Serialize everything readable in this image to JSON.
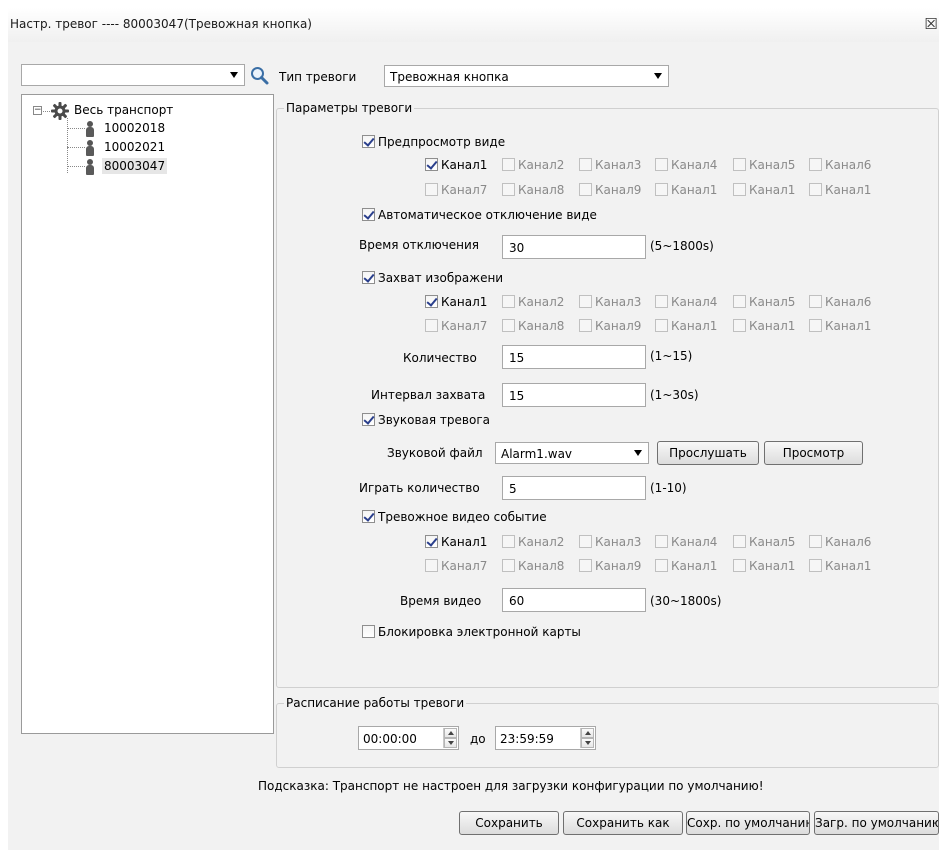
{
  "window": {
    "title": "Настр. тревог ---- 80003047(Тревожная кнопка)",
    "close_glyph": "☒"
  },
  "search": {
    "value": "",
    "icon": "search-icon"
  },
  "tree": {
    "root_label": "Весь транспорт",
    "items": [
      {
        "label": "10002018"
      },
      {
        "label": "10002021"
      },
      {
        "label": "80003047"
      }
    ]
  },
  "alarm_type": {
    "label": "Тип тревоги",
    "value": "Тревожная кнопка"
  },
  "params": {
    "legend": "Параметры тревоги",
    "preview": {
      "label": "Предпросмотр виде",
      "checked": true,
      "channels": [
        "Канал1",
        "Канал2",
        "Канал3",
        "Канал4",
        "Канал5",
        "Канал6",
        "Канал7",
        "Канал8",
        "Канал9",
        "Канал1",
        "Канал1",
        "Канал1"
      ]
    },
    "auto_off": {
      "label": "Автоматическое отключение виде",
      "checked": true
    },
    "off_time": {
      "label": "Время отключения",
      "value": "30",
      "hint": "(5~1800s)"
    },
    "capture": {
      "label": "Захват изображени",
      "checked": true,
      "channels": [
        "Канал1",
        "Канал2",
        "Канал3",
        "Канал4",
        "Канал5",
        "Канал6",
        "Канал7",
        "Канал8",
        "Канал9",
        "Канал1",
        "Канал1",
        "Канал1"
      ]
    },
    "count": {
      "label": "Количество",
      "value": "15",
      "hint": "(1~15)"
    },
    "interval": {
      "label": "Интервал захвата",
      "value": "15",
      "hint": "(1~30s)"
    },
    "sound": {
      "label": "Звуковая тревога",
      "checked": true
    },
    "sound_file": {
      "label": "Звуковой файл",
      "value": "Alarm1.wav",
      "listen_label": "Прослушать",
      "browse_label": "Просмотр"
    },
    "play_count": {
      "label": "Играть количество",
      "value": "5",
      "hint": "(1-10)"
    },
    "video_event": {
      "label": "Тревожное видео событие",
      "checked": true,
      "channels": [
        "Канал1",
        "Канал2",
        "Канал3",
        "Канал4",
        "Канал5",
        "Канал6",
        "Канал7",
        "Канал8",
        "Канал9",
        "Канал1",
        "Канал1",
        "Канал1"
      ]
    },
    "video_time": {
      "label": "Время видео",
      "value": "60",
      "hint": "(30~1800s)"
    },
    "emap_lock": {
      "label": "Блокировка электронной карты",
      "checked": false
    }
  },
  "schedule": {
    "legend": "Расписание работы тревоги",
    "start": "00:00:00",
    "to_label": "до",
    "end": "23:59:59"
  },
  "footer": {
    "hint": "Подсказка: Транспорт не настроен для загрузки конфигурации по умолчанию!",
    "save_label": "Сохранить",
    "save_as_label": "Сохранить как",
    "save_default_label": "Сохр. по умолчанию",
    "load_default_label": "Загр. по умолчанию"
  }
}
